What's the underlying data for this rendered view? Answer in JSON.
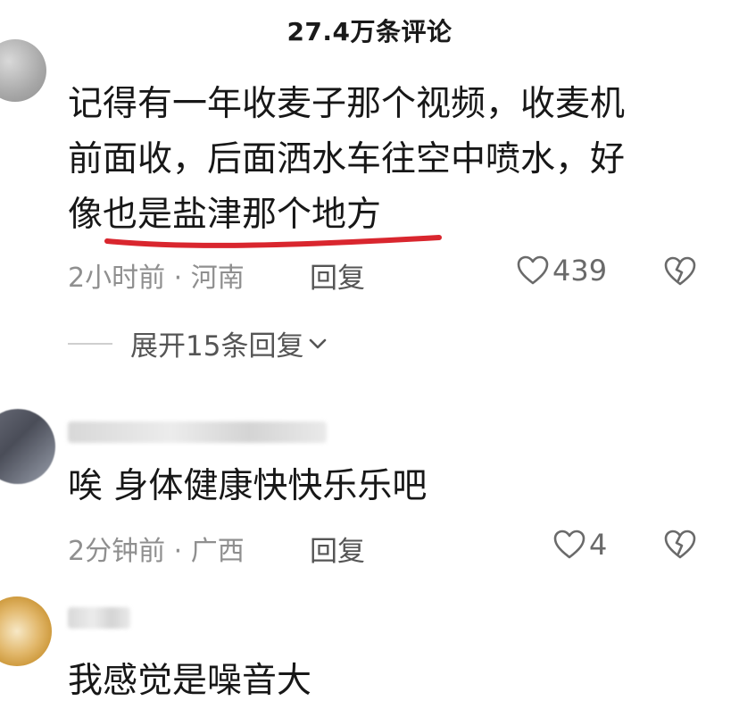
{
  "header": {
    "title": "27.4万条评论"
  },
  "comments": [
    {
      "text_lines": [
        "记得有一年收麦子那个视频，收麦机",
        "前面收，后面洒水车往空中喷水，好",
        "像也是盐津那个地方"
      ],
      "meta": "2小时前 · 河南",
      "reply_label": "回复",
      "likes": "439",
      "expand_label": "展开15条回复"
    },
    {
      "text_lines": [
        "唉 身体健康快快乐乐吧"
      ],
      "meta": "2分钟前 · 广西",
      "reply_label": "回复",
      "likes": "4"
    },
    {
      "text_lines": [
        "我感觉是噪音大"
      ]
    }
  ],
  "colors": {
    "underline": "#d9262e",
    "meta_gray": "#8f8f8f",
    "icon_gray": "#6a6a6a"
  },
  "icons": {
    "like": "heart-outline-icon",
    "dislike": "broken-heart-icon",
    "expand": "chevron-down-icon"
  }
}
